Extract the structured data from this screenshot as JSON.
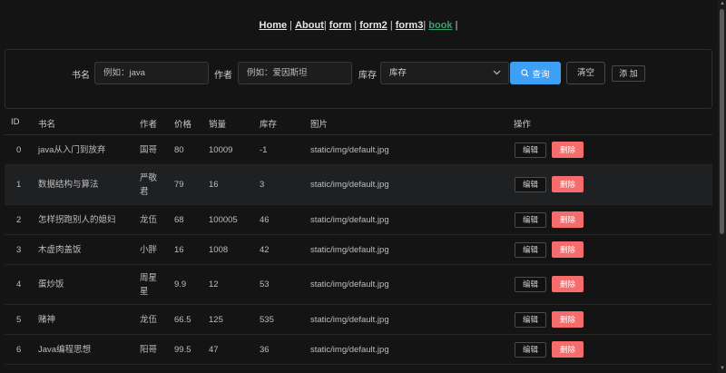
{
  "nav": {
    "links": [
      "Home",
      "About",
      "form",
      "form2",
      "form3",
      "book"
    ],
    "active": "book"
  },
  "search": {
    "book_label": "书名",
    "book_placeholder": "例如：java",
    "author_label": "作者",
    "author_placeholder": "例如：爱因斯坦",
    "stock_label": "库存",
    "stock_value": "库存",
    "search_button": "查询",
    "clear_button": "清空",
    "add_button": "添 加"
  },
  "table": {
    "headers": {
      "id": "ID",
      "name": "书名",
      "author": "作者",
      "price": "价格",
      "sales": "销量",
      "stock": "库存",
      "image": "图片",
      "actions": "操作"
    },
    "edit_label": "编辑",
    "delete_label": "删除",
    "rows": [
      {
        "id": "0",
        "name": "java从入门到放弃",
        "author": "国哥",
        "price": "80",
        "sales": "10009",
        "stock": "-1",
        "image": "static/img/default.jpg"
      },
      {
        "id": "1",
        "name": "数据结构与算法",
        "author": "严敬君",
        "price": "79",
        "sales": "16",
        "stock": "3",
        "image": "static/img/default.jpg"
      },
      {
        "id": "2",
        "name": "怎样拐跑别人的媳妇",
        "author": "龙伍",
        "price": "68",
        "sales": "100005",
        "stock": "46",
        "image": "static/img/default.jpg"
      },
      {
        "id": "3",
        "name": "木虚肉盖饭",
        "author": "小胖",
        "price": "16",
        "sales": "1008",
        "stock": "42",
        "image": "static/img/default.jpg"
      },
      {
        "id": "4",
        "name": "蛋炒饭",
        "author": "周星星",
        "price": "9.9",
        "sales": "12",
        "stock": "53",
        "image": "static/img/default.jpg"
      },
      {
        "id": "5",
        "name": "赌神",
        "author": "龙伍",
        "price": "66.5",
        "sales": "125",
        "stock": "535",
        "image": "static/img/default.jpg"
      },
      {
        "id": "6",
        "name": "Java编程思想",
        "author": "阳哥",
        "price": "99.5",
        "sales": "47",
        "stock": "36",
        "image": "static/img/default.jpg"
      }
    ]
  },
  "colors": {
    "accent": "#3d9ff5",
    "danger": "#f56c6c",
    "active_link": "#3aa16b"
  }
}
